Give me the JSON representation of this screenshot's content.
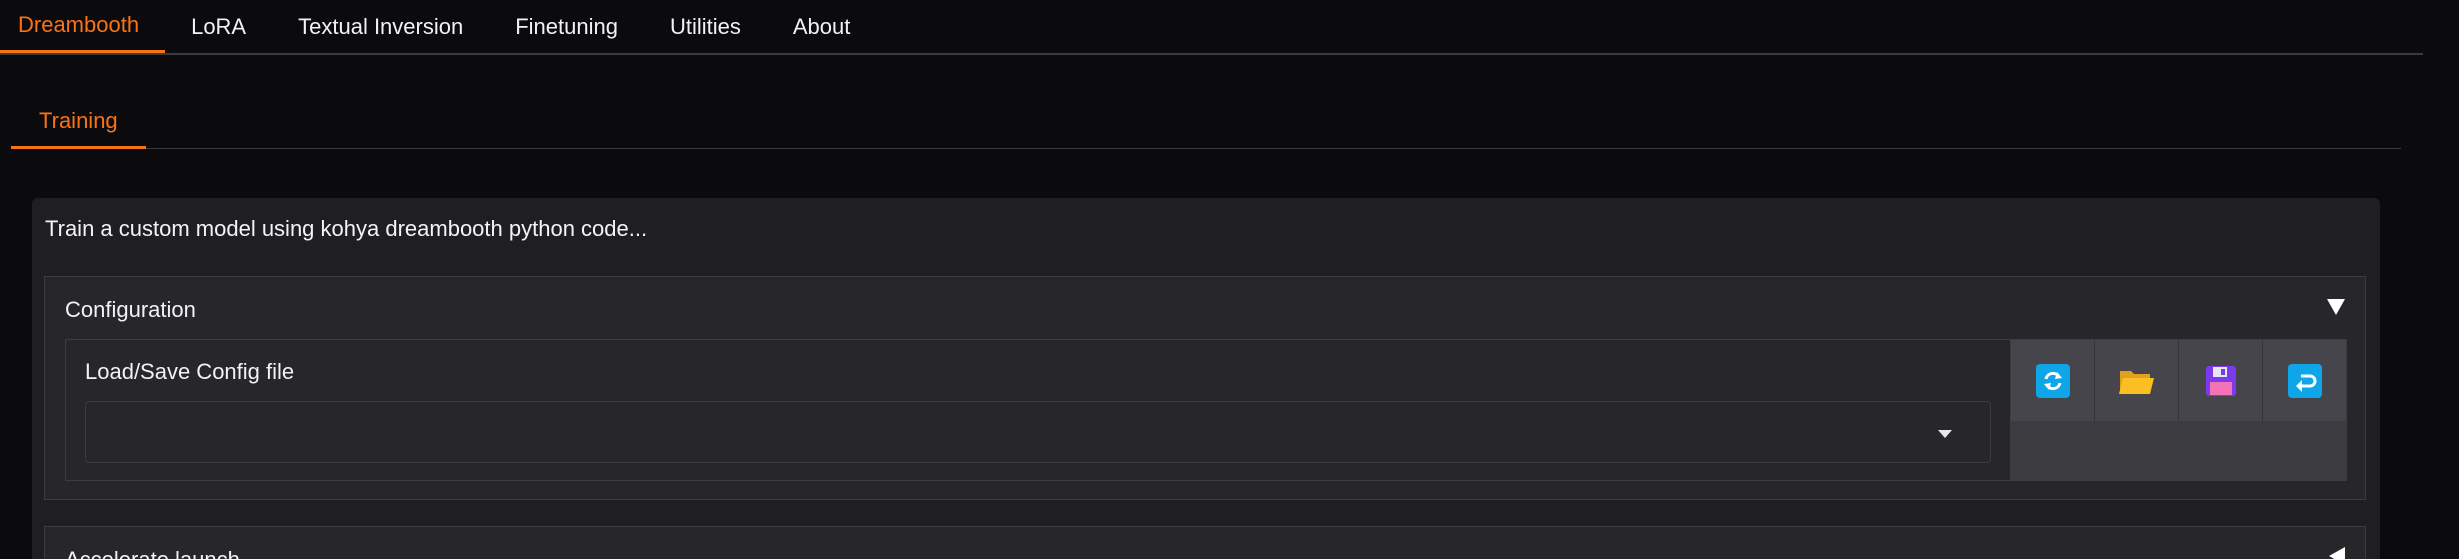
{
  "top_tabs": [
    {
      "label": "Dreambooth",
      "active": true
    },
    {
      "label": "LoRA",
      "active": false
    },
    {
      "label": "Textual Inversion",
      "active": false
    },
    {
      "label": "Finetuning",
      "active": false
    },
    {
      "label": "Utilities",
      "active": false
    },
    {
      "label": "About",
      "active": false
    }
  ],
  "sub_tabs": [
    {
      "label": "Training",
      "active": true
    }
  ],
  "panel": {
    "description": "Train a custom model using kohya dreambooth python code..."
  },
  "configuration": {
    "title": "Configuration",
    "expanded": true,
    "config_label": "Load/Save Config file",
    "selected_value": "",
    "buttons": [
      {
        "icon": "refresh-icon",
        "label": "Refresh"
      },
      {
        "icon": "folder-open-icon",
        "label": "Open"
      },
      {
        "icon": "save-icon",
        "label": "Save"
      },
      {
        "icon": "return-icon",
        "label": "Load"
      }
    ]
  },
  "accelerate": {
    "title": "Accelerate launch",
    "expanded": false
  },
  "colors": {
    "accent": "#f97316",
    "background": "#0b0b0d",
    "panel": "#1f1f22",
    "icon_blue": "#0ea5e9",
    "icon_folder": "#fbbf24",
    "icon_floppy": "#7c3aed"
  }
}
